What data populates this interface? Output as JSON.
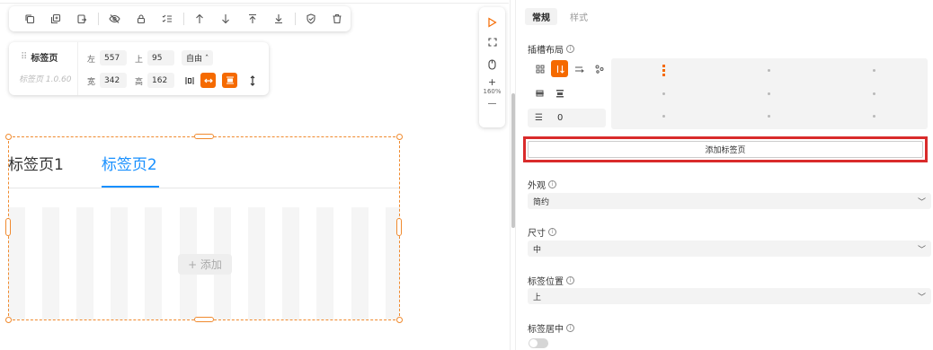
{
  "toolbar": {
    "icons": [
      "copy-icon",
      "copy-plus-icon",
      "clipboard-icon",
      "hide-icon",
      "lock-icon",
      "list-check-icon",
      "move-up-icon",
      "move-down-icon",
      "move-top-icon",
      "move-bottom-icon",
      "shield-check-icon",
      "trash-icon"
    ]
  },
  "component_card": {
    "name": "标签页",
    "version": "标签页 1.0.60",
    "left_label": "左",
    "left_value": "557",
    "top_label": "上",
    "top_value": "95",
    "mode": "自由 ˆ",
    "width_label": "宽",
    "width_value": "342",
    "height_label": "高",
    "height_value": "162"
  },
  "side_tools": {
    "zoom": "160%",
    "plus": "+",
    "minus": "—"
  },
  "canvas": {
    "tabs": [
      "标签页1",
      "标签页2"
    ],
    "active_tab": 1,
    "add_label": "+ 添加"
  },
  "panel": {
    "tabs": [
      "常规",
      "样式"
    ],
    "active_tab": 0,
    "slot_layout_label": "插槽布局",
    "gap_icon": "☰",
    "gap_value": "0",
    "add_tab_button": "添加标签页",
    "appearance_label": "外观",
    "appearance_value": "简约",
    "size_label": "尺寸",
    "size_value": "中",
    "position_label": "标签位置",
    "position_value": "上",
    "center_label": "标签居中",
    "center_enabled": false
  },
  "colors": {
    "accent": "#f56a00",
    "tab_active": "#1890ff",
    "highlight_border": "#d92b2b",
    "selection": "#f08a2e"
  }
}
